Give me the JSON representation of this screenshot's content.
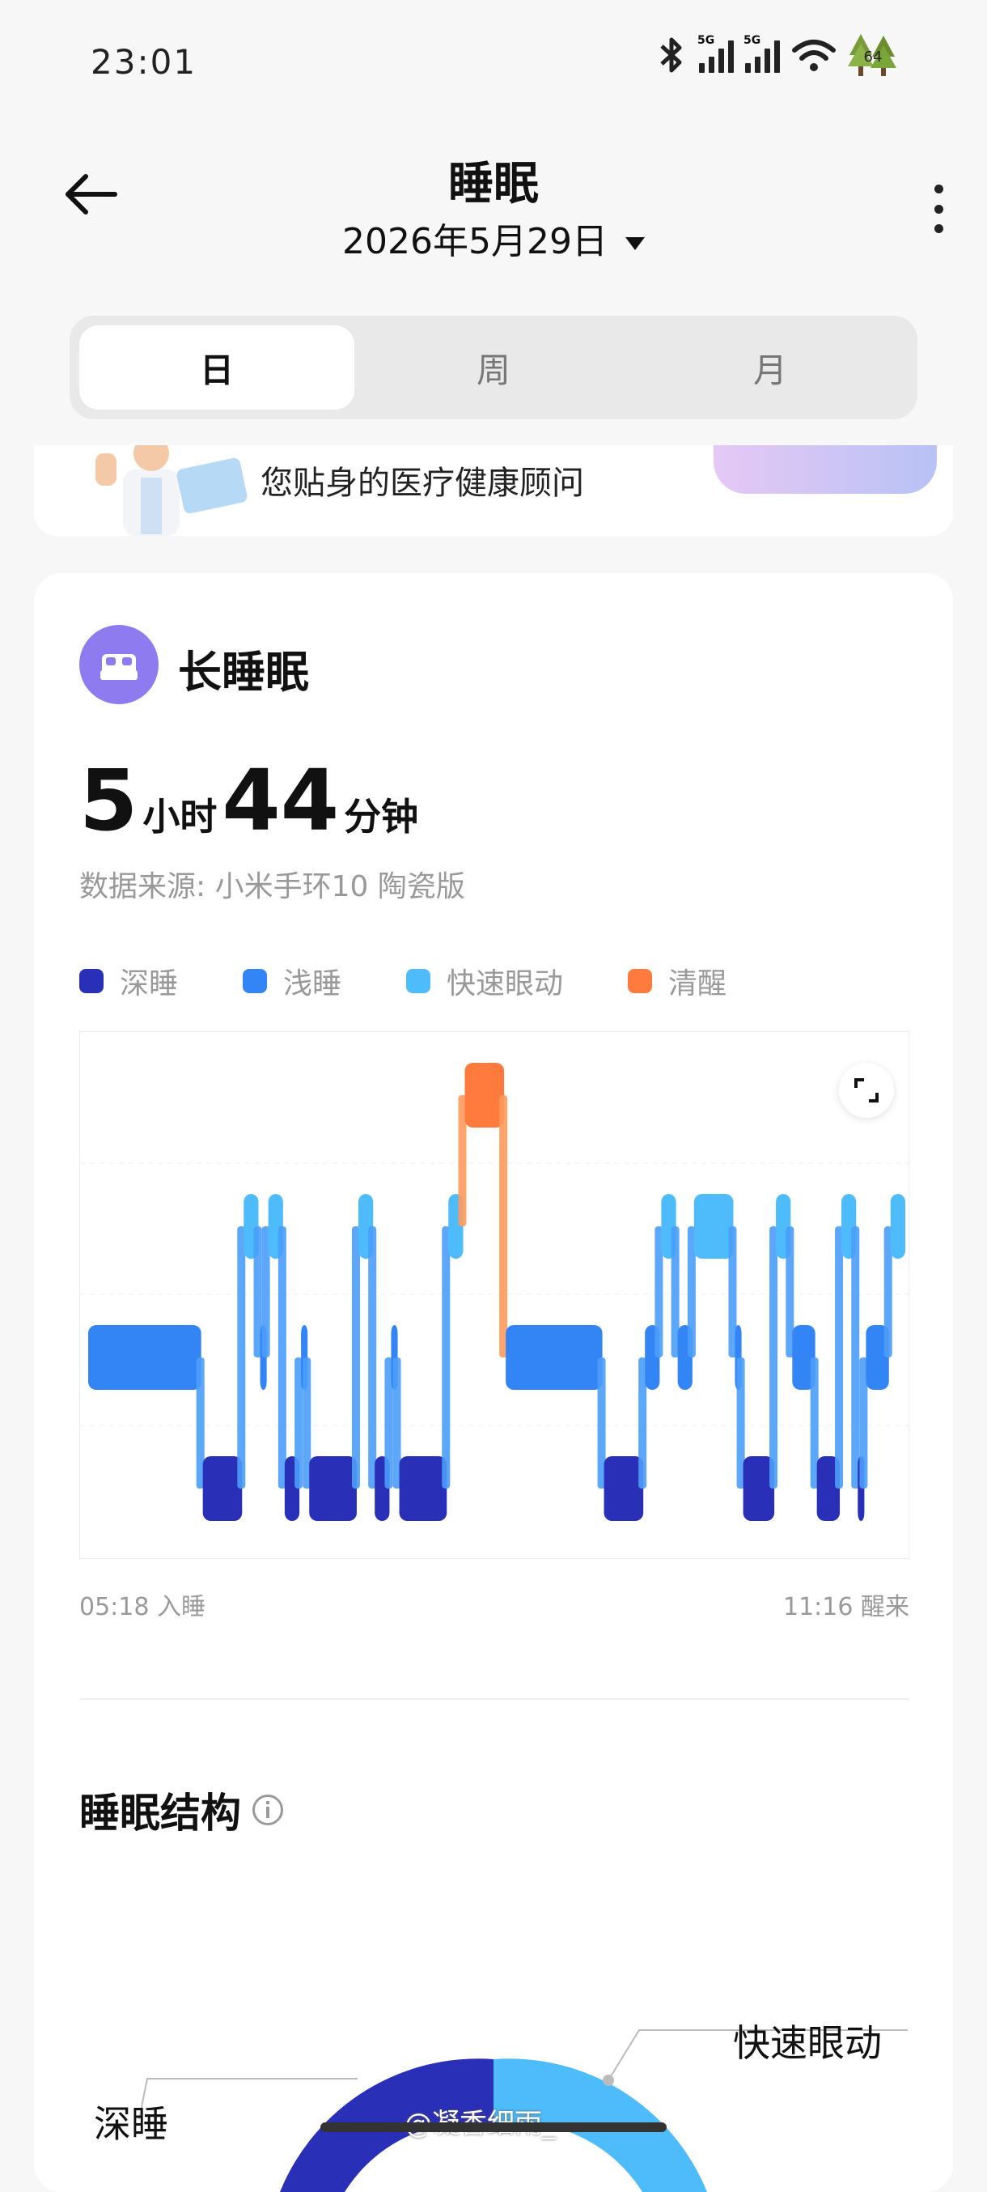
{
  "status_bar": {
    "time": "23:01",
    "network_tag_1": "5G",
    "network_tag_2": "5G",
    "battery": "64"
  },
  "header": {
    "title": "睡眠",
    "date": "2026年5月29日"
  },
  "segment_tabs": [
    {
      "label": "日",
      "active": true
    },
    {
      "label": "周",
      "active": false
    },
    {
      "label": "月",
      "active": false
    }
  ],
  "promo": {
    "text": "您贴身的医疗健康顾问"
  },
  "sleep_card": {
    "title": "长睡眠",
    "hours": "5",
    "hours_unit": "小时",
    "minutes": "44",
    "minutes_unit": "分钟",
    "source": "数据来源: 小米手环10 陶瓷版",
    "legend": [
      {
        "label": "深睡",
        "color": "#2a2fb8"
      },
      {
        "label": "浅睡",
        "color": "#3385f5"
      },
      {
        "label": "快速眼动",
        "color": "#4ebcfa"
      },
      {
        "label": "清醒",
        "color": "#ff7a3d"
      }
    ],
    "start_label": "05:18 入睡",
    "end_label": "11:16 醒来"
  },
  "structure": {
    "title": "睡眠结构",
    "label_rem": "快速眼动",
    "label_deep": "深睡"
  },
  "watermark": "@凝香细雨_",
  "chart_data": {
    "type": "sleep-stage-hypnogram",
    "stages": [
      "清醒",
      "快速眼动",
      "浅睡",
      "深睡"
    ],
    "start": "05:18",
    "end": "11:16",
    "segments": [
      {
        "stage": "浅睡",
        "from": 0,
        "to": 0.14
      },
      {
        "stage": "深睡",
        "from": 0.14,
        "to": 0.19
      },
      {
        "stage": "快速眼动",
        "from": 0.19,
        "to": 0.21
      },
      {
        "stage": "浅睡",
        "from": 0.21,
        "to": 0.22
      },
      {
        "stage": "快速眼动",
        "from": 0.22,
        "to": 0.24
      },
      {
        "stage": "深睡",
        "from": 0.24,
        "to": 0.26
      },
      {
        "stage": "浅睡",
        "from": 0.26,
        "to": 0.27
      },
      {
        "stage": "深睡",
        "from": 0.27,
        "to": 0.33
      },
      {
        "stage": "快速眼动",
        "from": 0.33,
        "to": 0.35
      },
      {
        "stage": "深睡",
        "from": 0.35,
        "to": 0.37
      },
      {
        "stage": "浅睡",
        "from": 0.37,
        "to": 0.38
      },
      {
        "stage": "深睡",
        "from": 0.38,
        "to": 0.44
      },
      {
        "stage": "快速眼动",
        "from": 0.44,
        "to": 0.46
      },
      {
        "stage": "清醒",
        "from": 0.46,
        "to": 0.51
      },
      {
        "stage": "浅睡",
        "from": 0.51,
        "to": 0.63
      },
      {
        "stage": "深睡",
        "from": 0.63,
        "to": 0.68
      },
      {
        "stage": "浅睡",
        "from": 0.68,
        "to": 0.7
      },
      {
        "stage": "快速眼动",
        "from": 0.7,
        "to": 0.72
      },
      {
        "stage": "浅睡",
        "from": 0.72,
        "to": 0.74
      },
      {
        "stage": "快速眼动",
        "from": 0.74,
        "to": 0.79
      },
      {
        "stage": "浅睡",
        "from": 0.79,
        "to": 0.8
      },
      {
        "stage": "深睡",
        "from": 0.8,
        "to": 0.84
      },
      {
        "stage": "快速眼动",
        "from": 0.84,
        "to": 0.86
      },
      {
        "stage": "浅睡",
        "from": 0.86,
        "to": 0.89
      },
      {
        "stage": "深睡",
        "from": 0.89,
        "to": 0.92
      },
      {
        "stage": "快速眼动",
        "from": 0.92,
        "to": 0.94
      },
      {
        "stage": "深睡",
        "from": 0.94,
        "to": 0.95
      },
      {
        "stage": "浅睡",
        "from": 0.95,
        "to": 0.98
      },
      {
        "stage": "快速眼动",
        "from": 0.98,
        "to": 1.0
      }
    ]
  }
}
